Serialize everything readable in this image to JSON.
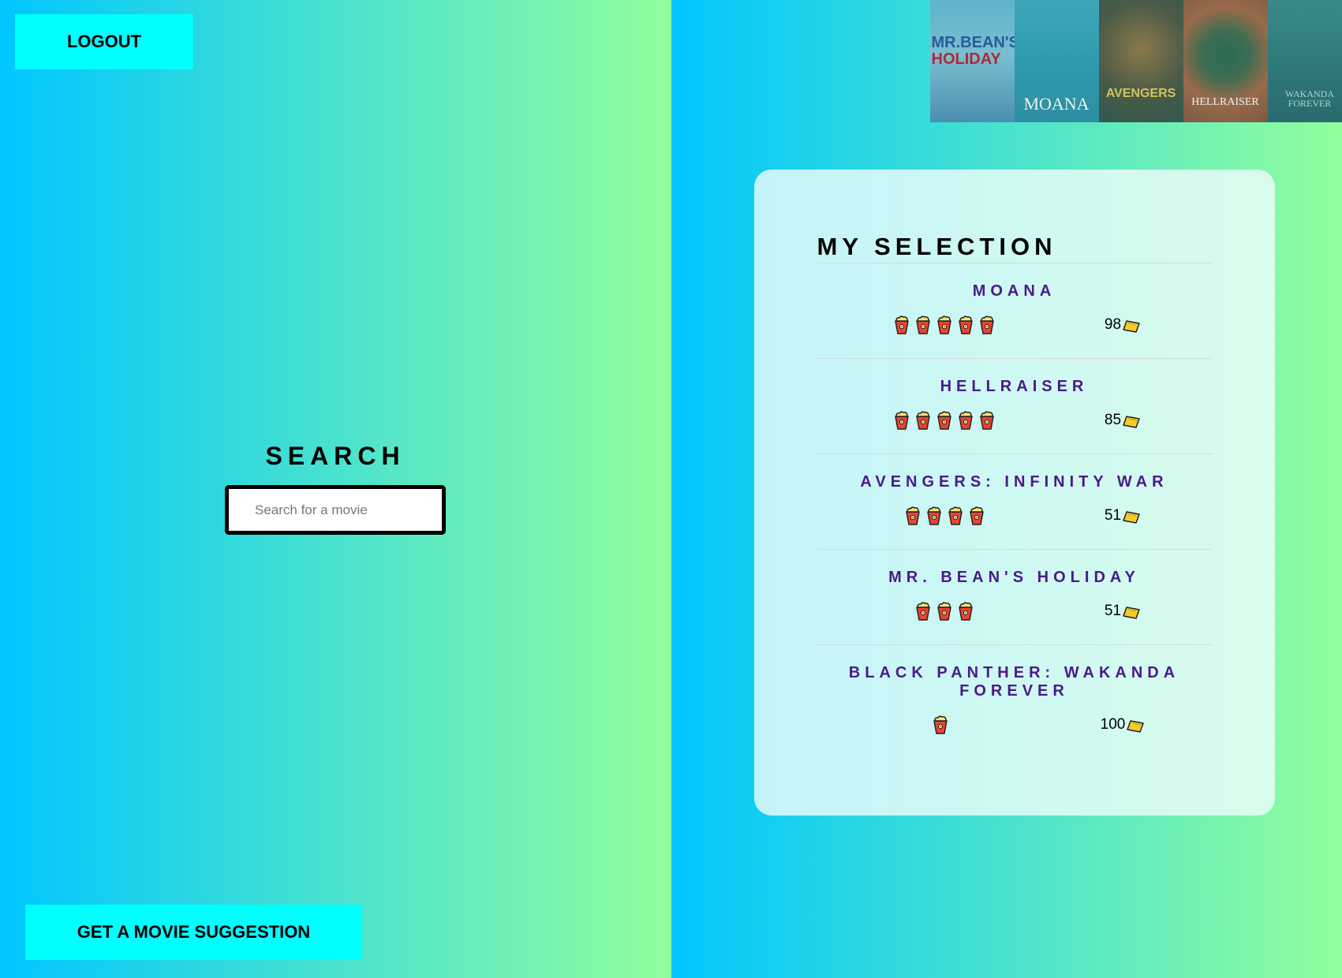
{
  "left": {
    "logout_label": "LOGOUT",
    "search_title": "SEARCH",
    "search_placeholder": "Search for a movie",
    "search_value": "",
    "suggest_label": "GET A MOVIE SUGGESTION"
  },
  "posters": [
    {
      "title_line1": "MR.BEAN'S",
      "title_line2": "HOLIDAY"
    },
    {
      "title": "MOANA"
    },
    {
      "title": "AVENGERS"
    },
    {
      "title": "HELLRAISER"
    },
    {
      "title": "WAKANDA FOREVER"
    }
  ],
  "selection": {
    "title": "MY SELECTION",
    "movies": [
      {
        "title": "MOANA",
        "rating": 5,
        "score": "98"
      },
      {
        "title": "HELLRAISER",
        "rating": 5,
        "score": "85"
      },
      {
        "title": "AVENGERS: INFINITY WAR",
        "rating": 4,
        "score": "51"
      },
      {
        "title": "MR. BEAN'S HOLIDAY",
        "rating": 3,
        "score": "51"
      },
      {
        "title": "BLACK PANTHER: WAKANDA FOREVER",
        "rating": 1,
        "score": "100"
      }
    ]
  },
  "icons": {
    "rating": "popcorn-icon",
    "score": "ticket-icon"
  },
  "colors": {
    "gradient_start": "#00c6ff",
    "gradient_end": "#92fe9d",
    "button": "#00ffff",
    "movie_title": "#4a1a8a"
  }
}
